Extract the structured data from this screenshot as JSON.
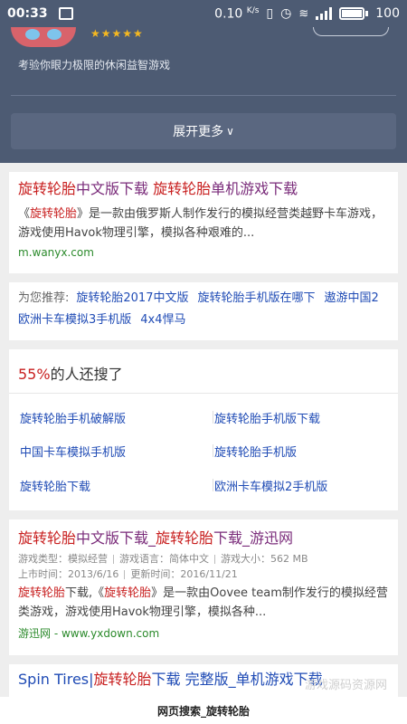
{
  "status_bar": {
    "time": "00:33",
    "speed": "0.10",
    "speed_unit": "K/s",
    "battery": "100"
  },
  "app_header": {
    "stars": "★★★★★",
    "description": "考验你眼力极限的休闲益智游戏",
    "expand_label": "展开更多",
    "expand_icon": "chevron-down-icon"
  },
  "result1": {
    "title_parts": [
      "旋转轮胎",
      "中文版下载 ",
      "旋转轮胎",
      "单机游戏下载"
    ],
    "body_parts": [
      "《",
      "旋转轮胎",
      "》是一款由俄罗斯人制作发行的模拟经营类越野卡车游戏，游戏使用Havok物理引擎，模拟各种艰难的..."
    ],
    "url": "m.wanyx.com"
  },
  "recommend": {
    "prefix": "为您推荐:",
    "links": [
      "旋转轮胎2017中文版",
      "旋转轮胎手机版在哪下",
      "遨游中国2",
      "欧洲卡车模拟3手机版",
      "4x4悍马"
    ]
  },
  "related": {
    "percent": "55%",
    "title_suffix": "的人还搜了",
    "items": [
      "旋转轮胎手机破解版",
      "旋转轮胎手机版下载",
      "中国卡车模拟手机版",
      "旋转轮胎手机版",
      "旋转轮胎下载",
      "欧洲卡车模拟2手机版"
    ]
  },
  "result2": {
    "title_parts": [
      "旋转轮胎",
      "中文版下载_",
      "旋转轮胎",
      "下载_游迅网"
    ],
    "meta": {
      "type": "游戏类型：模拟经营",
      "lang": "游戏语言：简体中文",
      "size": "游戏大小：562 MB",
      "release": "上市时间：2013/6/16",
      "update": "更新时间：2016/11/21"
    },
    "body_parts": [
      "旋转轮胎",
      "下载,《",
      "旋转轮胎",
      "》是一款由Oovee team制作发行的模拟经营类游戏，游戏使用Havok物理引擎，模拟各种..."
    ],
    "url": "游迅网 - www.yxdown.com"
  },
  "result3": {
    "title_parts": [
      "Spin Tires|",
      "旋转轮胎",
      "下载 完整版_单机游戏下载"
    ]
  },
  "watermark": "游戏源码资源网",
  "footer_title": "网页搜索_旋转轮胎",
  "colors": {
    "header_bg": "#4d5b73",
    "highlight_red": "#c81f1f",
    "link_blue": "#1f4bb5",
    "visited_purple": "#7a2b7a",
    "url_green": "#2b8a2b"
  }
}
